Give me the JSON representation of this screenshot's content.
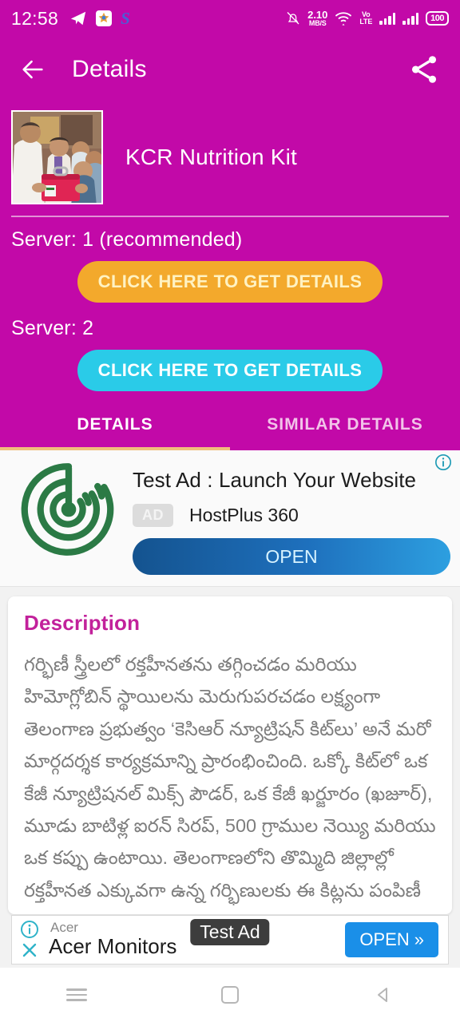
{
  "statusbar": {
    "time": "12:58",
    "telegram_icon": "telegram-icon",
    "app_icon_letter": "S",
    "network_speed_value": "2.10",
    "network_speed_unit": "MB/S",
    "volte_top": "Vo",
    "volte_bottom": "LTE",
    "battery_level": "100"
  },
  "appbar": {
    "title": "Details",
    "back_icon": "back-arrow-icon",
    "share_icon": "share-icon"
  },
  "hero": {
    "title": "KCR Nutrition Kit",
    "thumbnail_alt": "photo of officials handing over a red nutrition kit"
  },
  "servers": [
    {
      "label": "Server: 1 (recommended)",
      "button_label": "CLICK HERE TO GET DETAILS",
      "color": "#F3A92C"
    },
    {
      "label": "Server: 2",
      "button_label": "CLICK HERE TO GET DETAILS",
      "color": "#2ACBE8"
    }
  ],
  "tabs": [
    {
      "label": "DETAILS",
      "active": true
    },
    {
      "label": "SIMILAR DETAILS",
      "active": false
    }
  ],
  "native_ad": {
    "headline": "Test Ad : Launch Your Website",
    "badge": "AD",
    "advertiser": "HostPlus 360",
    "cta": "OPEN",
    "info_icon": "info-icon",
    "logo_icon": "radar-logo-icon"
  },
  "description": {
    "title": "Description",
    "body": "గర్భిణీ స్త్రీలలో రక్తహీనతను తగ్గించడం మరియు హిమోగ్లోబిన్ స్థాయిలను మెరుగుపరచడం లక్ష్యంగా తెలంగాణ ప్రభుత్వం ‘కెసిఆర్ న్యూట్రిషన్ కిట్‌లు’ అనే మరో మార్గదర్శక కార్యక్రమాన్ని ప్రారంభించింది. ఒక్కో కిట్‌లో ఒక కేజీ న్యూట్రిషనల్ మిక్స్ పౌడర్, ఒక కేజీ ఖర్జూరం (ఖజూర్), మూడు బాటిళ్ల ఐరన్ సిరప్, 500 గ్రాముల నెయ్యి మరియు ఒక కప్పు ఉంటాయి. తెలంగాణలోని తొమ్మిది జిల్లాల్లో రక్తహీనత ఎక్కువగా ఉన్న గర్భిణులకు ఈ కిట్లను పంపిణీ"
  },
  "banner_ad": {
    "brand": "Acer",
    "title": "Acer Monitors",
    "test_badge": "Test Ad",
    "cta": "OPEN",
    "cta_chevron": "»",
    "info_icon": "info-icon",
    "close_icon": "close-icon"
  },
  "navbar": {
    "recents_icon": "recents-icon",
    "home_icon": "home-icon",
    "back_icon": "back-triangle-icon"
  },
  "colors": {
    "brand_magenta": "#C209A8",
    "server1_orange": "#F3A92C",
    "server2_cyan": "#2ACBE8",
    "tab_indicator": "#F0BE7C",
    "description_heading": "#C2219B",
    "banner_cta_blue": "#1A8FE8"
  }
}
